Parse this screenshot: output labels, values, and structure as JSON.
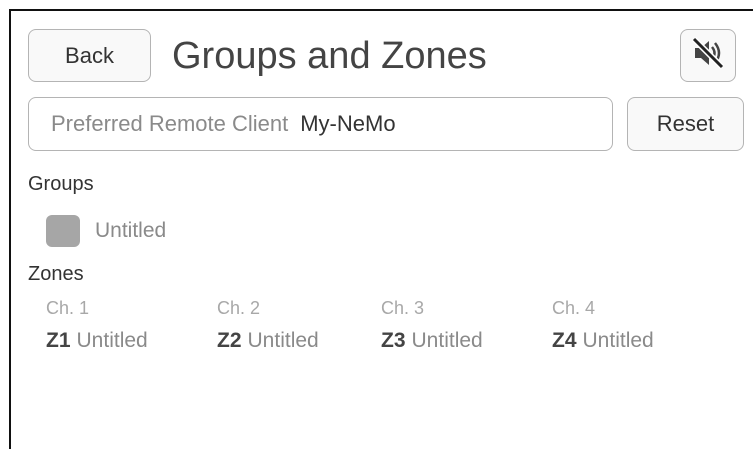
{
  "header": {
    "back_label": "Back",
    "title": "Groups and Zones",
    "mute_icon": "muted-speaker-icon"
  },
  "remote_client": {
    "label": "Preferred Remote Client",
    "value": "My-NeMo",
    "reset_label": "Reset"
  },
  "groups": {
    "heading": "Groups",
    "items": [
      {
        "name": "Untitled",
        "color": "#a6a6a6"
      }
    ]
  },
  "zones": {
    "heading": "Zones",
    "items": [
      {
        "channel": "Ch. 1",
        "id": "Z1",
        "name": "Untitled"
      },
      {
        "channel": "Ch. 2",
        "id": "Z2",
        "name": "Untitled"
      },
      {
        "channel": "Ch. 3",
        "id": "Z3",
        "name": "Untitled"
      },
      {
        "channel": "Ch. 4",
        "id": "Z4",
        "name": "Untitled"
      }
    ]
  }
}
